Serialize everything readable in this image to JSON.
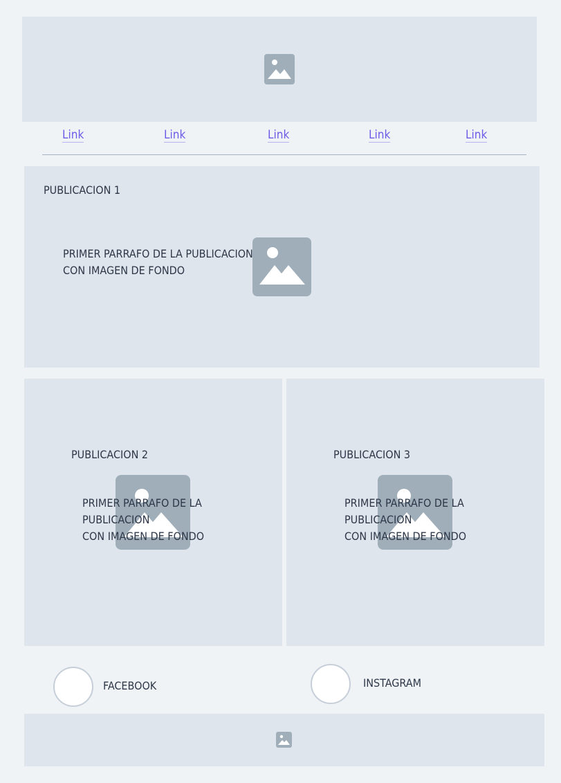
{
  "header": {
    "image_icon": "image-icon"
  },
  "nav": {
    "links": [
      "Link",
      "Link",
      "Link",
      "Link",
      "Link"
    ]
  },
  "post1": {
    "title": "PUBLICACION 1",
    "paragraph_line1": "PRIMER PARRAFO DE LA PUBLICACION",
    "paragraph_line2": "CON IMAGEN DE FONDO",
    "image_icon": "image-icon"
  },
  "post2": {
    "title": "PUBLICACION 2",
    "paragraph_line1": "PRIMER PARRAFO DE LA",
    "paragraph_line2": "PUBLICACION",
    "paragraph_line3": "CON IMAGEN DE FONDO",
    "image_icon": "image-icon"
  },
  "post3": {
    "title": "PUBLICACION 3",
    "paragraph_line1": "PRIMER PARRAFO DE LA",
    "paragraph_line2": "PUBLICACION",
    "paragraph_line3": "CON IMAGEN DE FONDO",
    "image_icon": "image-icon"
  },
  "social": {
    "facebook_label": "FACEBOOK",
    "instagram_label": "INSTAGRAM"
  },
  "footer": {
    "image_icon": "image-icon"
  },
  "colors": {
    "panel": "#dfe5ec",
    "placeholder": "#a0aeba",
    "link": "#6b5ce7",
    "background": "#f0f3f6"
  }
}
